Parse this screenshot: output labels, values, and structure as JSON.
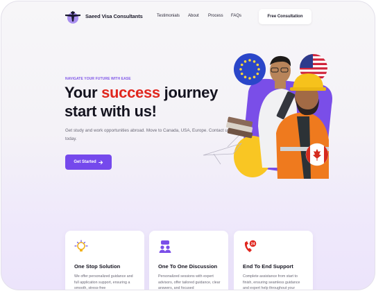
{
  "nav": {
    "brand": "Saeed Visa Consultants",
    "links": [
      "Testimonials",
      "About",
      "Process",
      "FAQs"
    ],
    "cta": "Free Consultation"
  },
  "hero": {
    "eyebrow": "NAVIGATE YOUR FUTURE WITH EASE",
    "headline_line1_prefix": "Your ",
    "headline_accent": "success",
    "headline_line1_suffix": " journey",
    "headline_line2": "start with us!",
    "subtext": "Get study and work opportunities abroad. Move to Canada, USA, Europe. Contact us today.",
    "cta": "Get Started",
    "cta_icon": "arrow-right-icon"
  },
  "cards": [
    {
      "icon": "lightbulb-gear-icon",
      "title": "One Stop Solution",
      "text": "We offer personalized guidance and full application support, ensuring a smooth, stress-free"
    },
    {
      "icon": "people-chat-icon",
      "title": "One To One Discussion",
      "text": "Personalized sessions with expert advisors, offer tailored guidance, clear answers, and focused"
    },
    {
      "icon": "24-hour-phone-icon",
      "title": "End To End Support",
      "text": "Complete assistance from start to finish, ensuring seamless guidance and expert help throughout your"
    }
  ],
  "colors": {
    "accent_purple": "#7549ec",
    "accent_red": "#e0261e",
    "heading": "#14131f",
    "body_text": "#6a6876"
  }
}
